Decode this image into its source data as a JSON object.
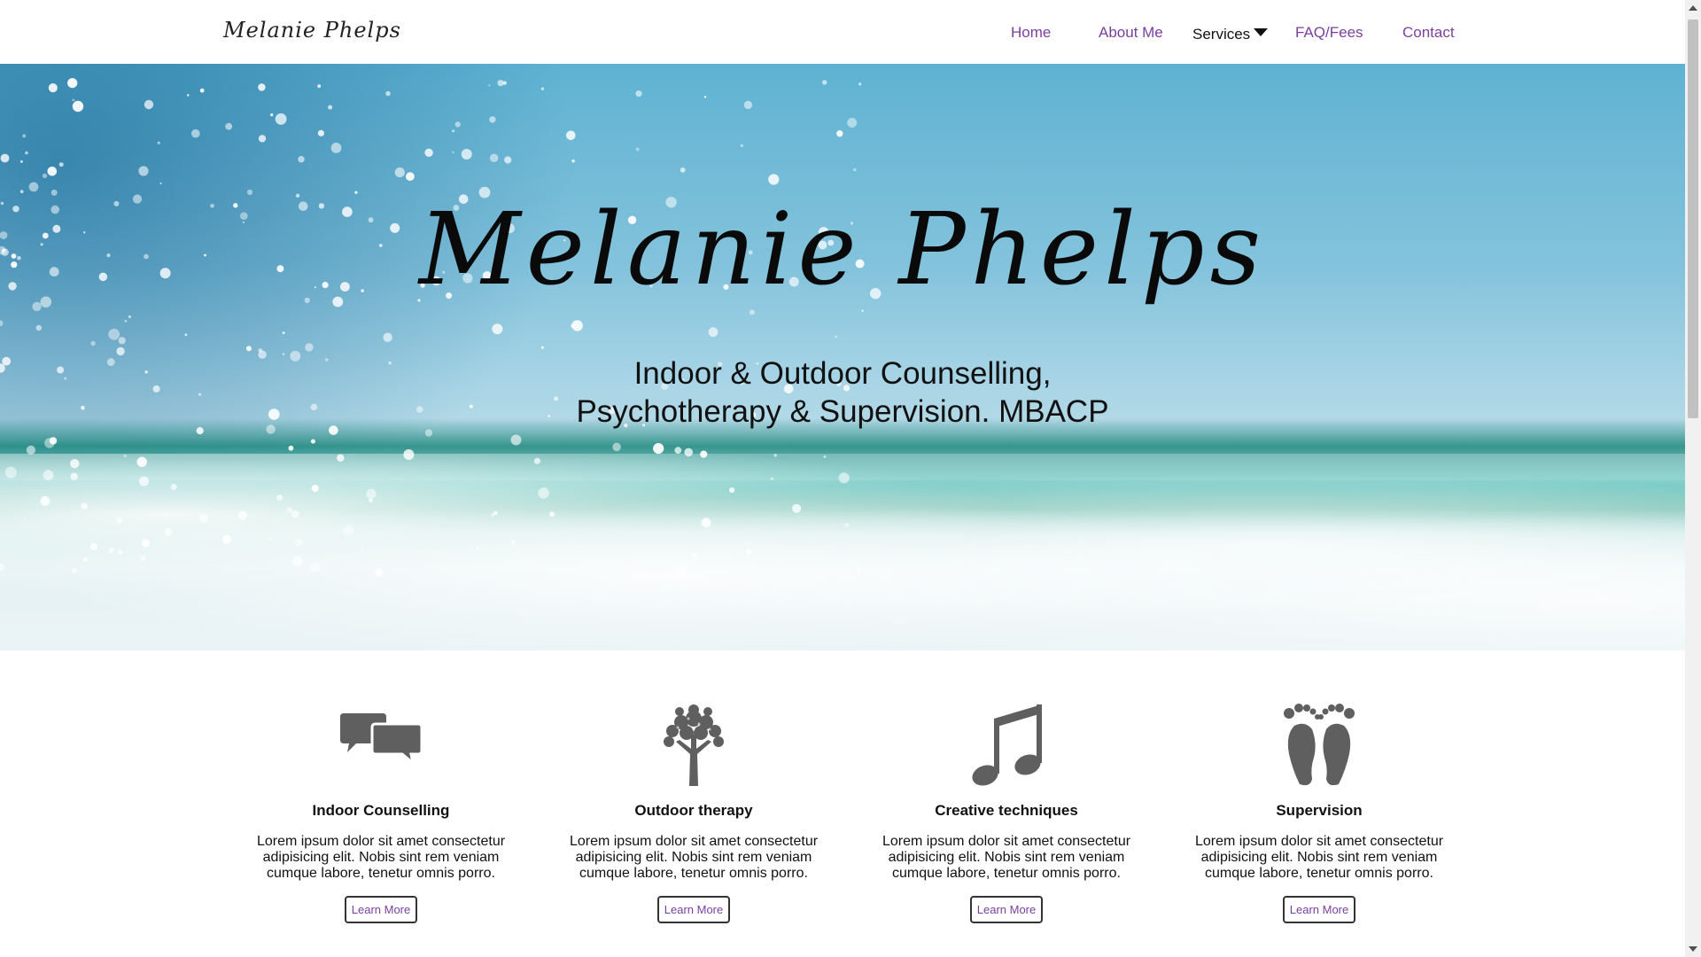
{
  "brand": {
    "name": "Melanie Phelps"
  },
  "nav": {
    "home": "Home",
    "about": "About Me",
    "services": "Services",
    "faq": "FAQ/Fees",
    "contact": "Contact"
  },
  "hero": {
    "title": "Melanie Phelps",
    "subtitle_line1": "Indoor & Outdoor Counselling,",
    "subtitle_line2": "Psychotherapy & Supervision. MBACP"
  },
  "services": [
    {
      "icon": "speech-bubbles-icon",
      "title": "Indoor Counselling",
      "text": "Lorem ipsum dolor sit amet consectetur adipisicing elit. Nobis sint rem veniam cumque labore, tenetur omnis porro.",
      "button": "Learn More"
    },
    {
      "icon": "tree-icon",
      "title": "Outdoor therapy",
      "text": "Lorem ipsum dolor sit amet consectetur adipisicing elit. Nobis sint rem veniam cumque labore, tenetur omnis porro.",
      "button": "Learn More"
    },
    {
      "icon": "music-note-icon",
      "title": "Creative techniques",
      "text": "Lorem ipsum dolor sit amet consectetur adipisicing elit. Nobis sint rem veniam cumque labore, tenetur omnis porro.",
      "button": "Learn More"
    },
    {
      "icon": "footprints-icon",
      "title": "Supervision",
      "text": "Lorem ipsum dolor sit amet consectetur adipisicing elit. Nobis sint rem veniam cumque labore, tenetur omnis porro.",
      "button": "Learn More"
    }
  ],
  "colors": {
    "link": "#7b3f9e",
    "icon": "#5f5f5f",
    "text": "#111111"
  }
}
